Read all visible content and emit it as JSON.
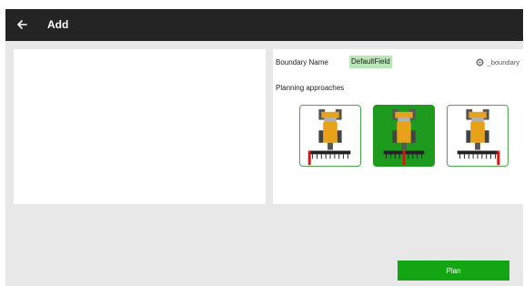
{
  "header": {
    "title": "Add",
    "back_icon": "arrow-left-icon"
  },
  "boundary": {
    "label": "Boundary Name",
    "value": "DefaultField",
    "link_icon": "gear-icon",
    "link_text": "_boundary"
  },
  "planning": {
    "label": "Planning approaches",
    "approaches": [
      {
        "marker": "left",
        "selected": false
      },
      {
        "marker": "center",
        "selected": true
      },
      {
        "marker": "right",
        "selected": false
      }
    ]
  },
  "actions": {
    "plan_label": "Plan"
  },
  "colors": {
    "header_bg": "#242424",
    "accent_green": "#14a514",
    "selected_bg": "#1e9a1e",
    "highlight_field": "#b8e6b8",
    "tractor_body": "#e8a21a",
    "marker_red": "#e01010"
  }
}
